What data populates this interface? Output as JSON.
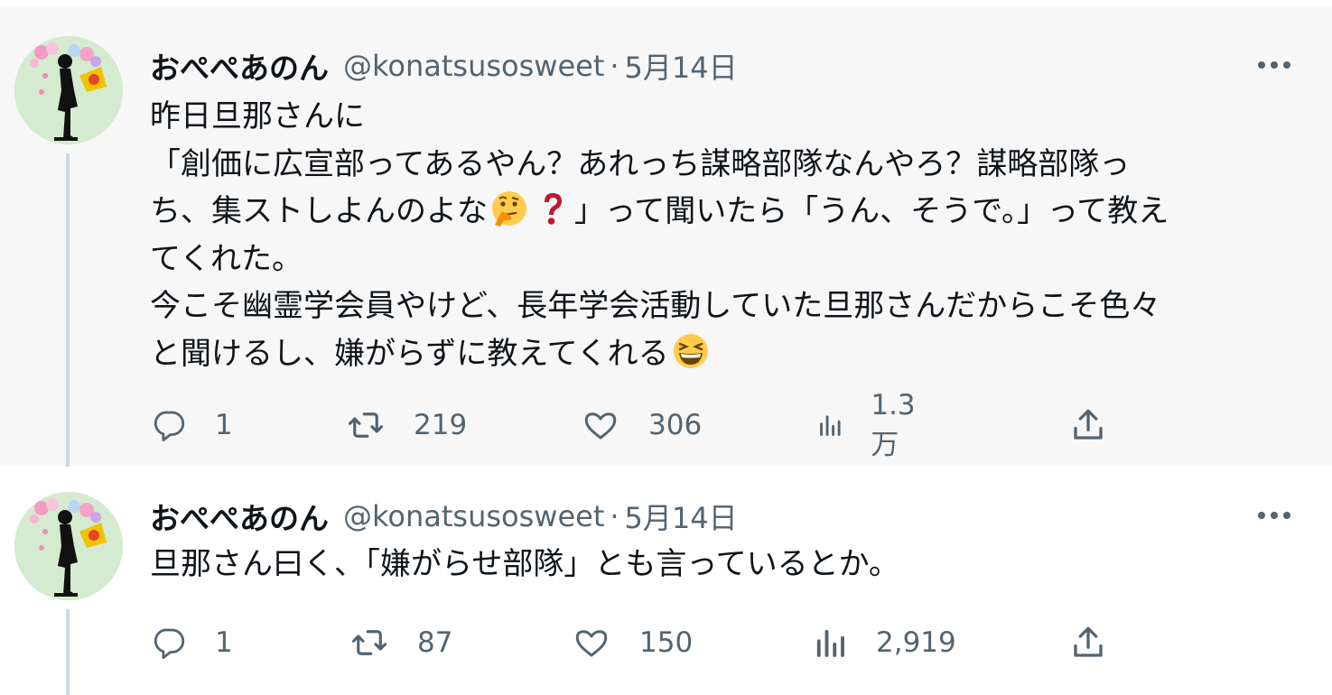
{
  "tweets": [
    {
      "author": {
        "name": "おぺぺあのん",
        "handle": "@konatsusosweet",
        "avatar_icon": "silhouette-flower-avatar-icon"
      },
      "separator": "·",
      "date": "5月14日",
      "body": {
        "text1": "昨日旦那さんに\n「創価に広宣部ってあるやん？あれっち謀略部隊なんやろ？謀略部隊っ\nち、集ストしよんのよな",
        "emoji1": "thinking-face-emoji",
        "emoji2": "red-question-mark-emoji",
        "text2": "」って聞いたら「うん、そうで。」って教え\nてくれた。\n今こそ幽霊学会員やけど、長年学会活動していた旦那さんだからこそ色々\nと聞けるし、嫌がらずに教えてくれる",
        "emoji3": "grinning-squinting-face-emoji"
      },
      "actions": {
        "replies": "1",
        "retweets": "219",
        "likes": "306",
        "views": "1.3万"
      }
    },
    {
      "author": {
        "name": "おぺぺあのん",
        "handle": "@konatsusosweet",
        "avatar_icon": "silhouette-flower-avatar-icon"
      },
      "separator": "·",
      "date": "5月14日",
      "body": {
        "text1": "旦那さん曰く、「嫌がらせ部隊」とも言っているとか。"
      },
      "actions": {
        "replies": "1",
        "retweets": "87",
        "likes": "150",
        "views": "2,919"
      }
    }
  ],
  "colors": {
    "background_tweet1": "#f7f7f7",
    "background_tweet2": "#ffffff",
    "text_primary": "#0f1419",
    "text_secondary": "#536471",
    "thread_line": "#cfd9de"
  }
}
